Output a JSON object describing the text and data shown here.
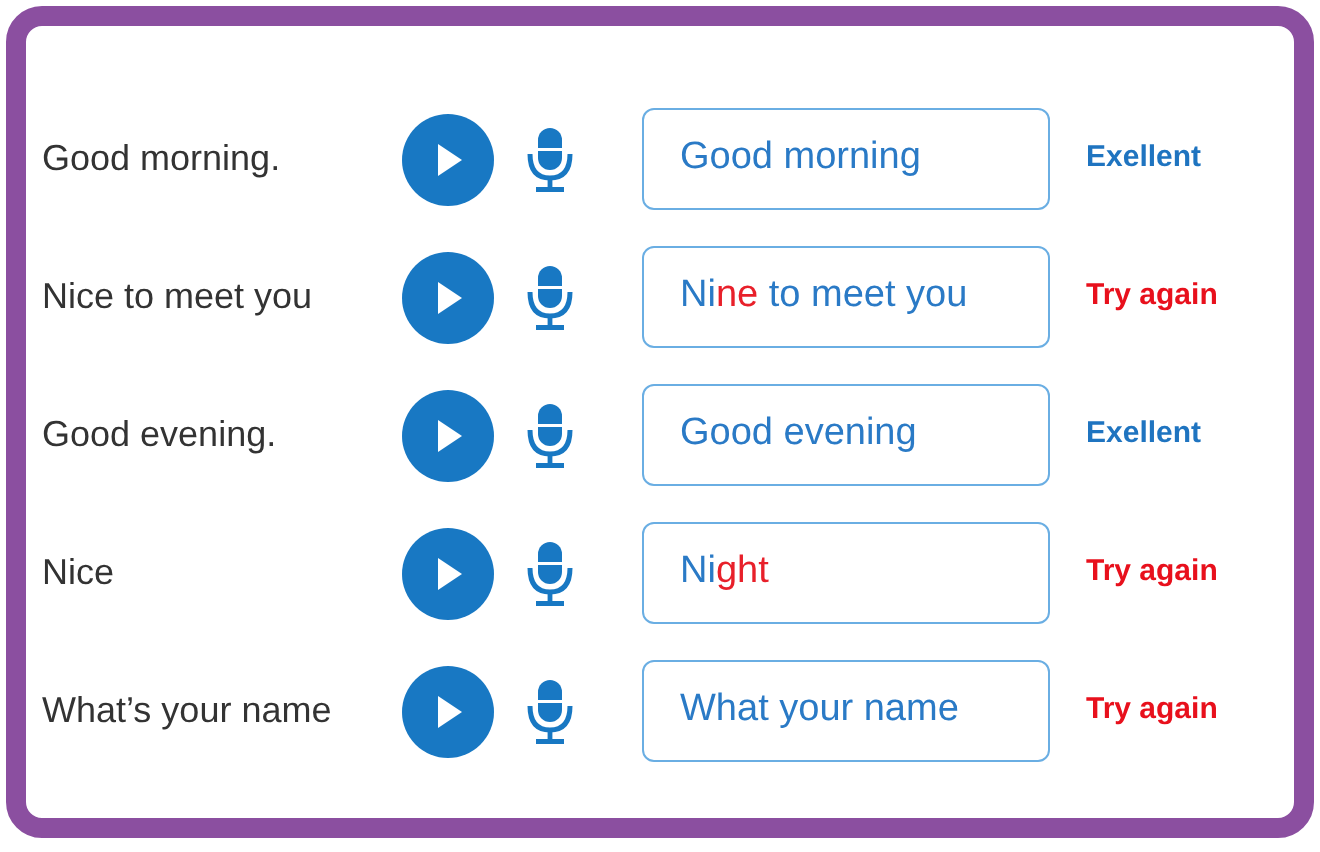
{
  "rows": [
    {
      "phrase": "Good morning.",
      "answer": [
        {
          "text": "Good morning",
          "wrong": false
        }
      ],
      "result": {
        "text": "Exellent",
        "kind": "correct"
      }
    },
    {
      "phrase": "Nice to meet you",
      "answer": [
        {
          "text": "Ni",
          "wrong": false
        },
        {
          "text": "ne",
          "wrong": true
        },
        {
          "text": " to meet you",
          "wrong": false
        }
      ],
      "result": {
        "text": "Try again",
        "kind": "retry"
      }
    },
    {
      "phrase": "Good evening.",
      "answer": [
        {
          "text": "Good evening",
          "wrong": false
        }
      ],
      "result": {
        "text": "Exellent",
        "kind": "correct"
      }
    },
    {
      "phrase": "Nice",
      "answer": [
        {
          "text": "Ni",
          "wrong": false
        },
        {
          "text": "ght",
          "wrong": true
        }
      ],
      "result": {
        "text": "Try again",
        "kind": "retry"
      }
    },
    {
      "phrase": "What’s your name",
      "answer": [
        {
          "text": "What your name",
          "wrong": false
        }
      ],
      "result": {
        "text": "Try again",
        "kind": "retry"
      }
    }
  ]
}
